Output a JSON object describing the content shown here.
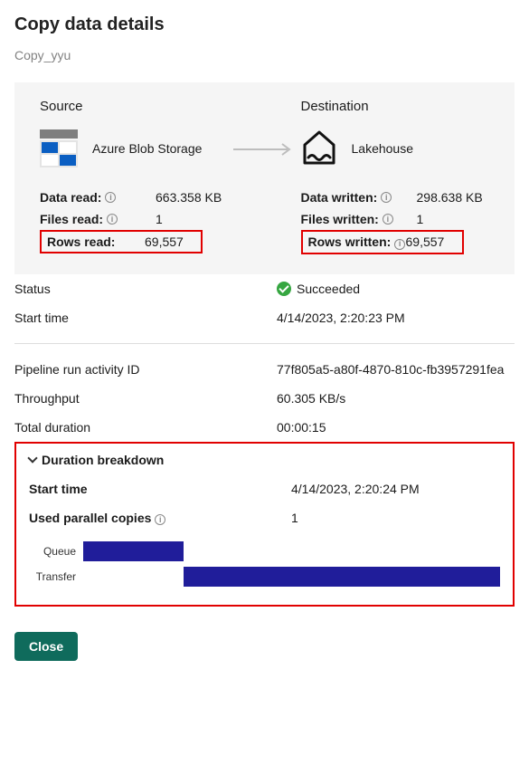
{
  "title": "Copy data details",
  "subtitle": "Copy_yyu",
  "source": {
    "heading": "Source",
    "type_label": "Azure Blob Storage",
    "stats": {
      "data_read_label": "Data read:",
      "data_read_value": "663.358 KB",
      "files_read_label": "Files read:",
      "files_read_value": "1",
      "rows_read_label": "Rows read:",
      "rows_read_value": "69,557"
    }
  },
  "destination": {
    "heading": "Destination",
    "type_label": "Lakehouse",
    "stats": {
      "data_written_label": "Data written:",
      "data_written_value": "298.638 KB",
      "files_written_label": "Files written:",
      "files_written_value": "1",
      "rows_written_label": "Rows written:",
      "rows_written_value": "69,557"
    }
  },
  "run": {
    "status_label": "Status",
    "status_value": "Succeeded",
    "start_time_label": "Start time",
    "start_time_value": "4/14/2023, 2:20:23 PM",
    "activity_id_label": "Pipeline run activity ID",
    "activity_id_value": "77f805a5-a80f-4870-810c-fb3957291fea",
    "throughput_label": "Throughput",
    "throughput_value": "60.305 KB/s",
    "total_duration_label": "Total duration",
    "total_duration_value": "00:00:15"
  },
  "breakdown": {
    "heading": "Duration breakdown",
    "start_time_label": "Start time",
    "start_time_value": "4/14/2023, 2:20:24 PM",
    "parallel_label": "Used parallel copies",
    "parallel_value": "1",
    "bars": {
      "queue_label": "Queue",
      "transfer_label": "Transfer"
    }
  },
  "close_label": "Close",
  "chart_data": {
    "type": "bar",
    "title": "Duration breakdown",
    "series": [
      {
        "name": "Queue",
        "start_pct": 0,
        "width_pct": 24
      },
      {
        "name": "Transfer",
        "start_pct": 24,
        "width_pct": 76
      }
    ],
    "xlim_pct": [
      0,
      100
    ]
  }
}
